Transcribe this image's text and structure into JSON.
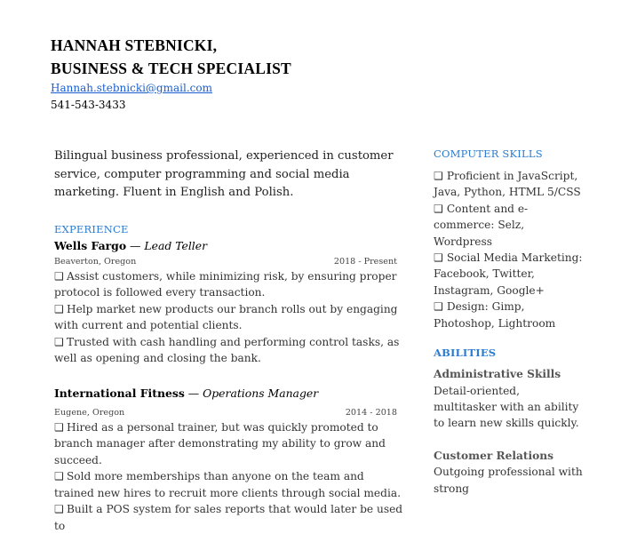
{
  "header": {
    "name_line1": "HANNAH STEBNICKI,",
    "name_line2": "BUSINESS &  TECH SPECIALIST",
    "email": "Hannah.stebnicki@gmail.com",
    "phone": "541-543-3433"
  },
  "summary": "Bilingual business professional, experienced in customer service, computer programming and social media marketing. Fluent in English and Polish.",
  "experience": {
    "title": "EXPERIENCE",
    "jobs": [
      {
        "company": "Wells Fargo",
        "sep": " — ",
        "role": "Lead Teller",
        "location": "Beaverton, Oregon",
        "dates": "2018 - Present",
        "bullets": [
          "Assist customers, while minimizing risk, by ensuring proper protocol is followed every transaction.",
          "Help market new products our branch rolls out by engaging with current and potential clients.",
          "Trusted with cash handling and performing control tasks, as well as opening and closing the bank."
        ]
      },
      {
        "company": "International Fitness",
        "sep": " — ",
        "role": "Operations Manager",
        "location": "Eugene, Oregon",
        "dates": "2014 - 2018",
        "bullets": [
          "Hired as a personal trainer, but was quickly promoted to branch manager after demonstrating my ability to grow and succeed.",
          "Sold more memberships than anyone on the team and trained new hires to recruit more clients through social media.",
          "Built a POS system for sales reports that would later be used to"
        ]
      }
    ]
  },
  "computer_skills": {
    "title": "COMPUTER SKILLS",
    "items": [
      "Proficient in JavaScript, Java, Python, HTML 5/CSS",
      "Content and e-commerce: Selz, Wordpress",
      "Social Media Marketing: Facebook, Twitter, Instagram, Google+",
      "Design: Gimp, Photoshop, Lightroom"
    ]
  },
  "abilities": {
    "title": "ABILITIES",
    "items": [
      {
        "name": "Administrative Skills",
        "desc": "Detail-oriented, multitasker with an ability to learn new skills quickly."
      },
      {
        "name": "Customer Relations",
        "desc": "Outgoing  professional with strong"
      }
    ]
  },
  "icons": {
    "bullet": "❑"
  }
}
